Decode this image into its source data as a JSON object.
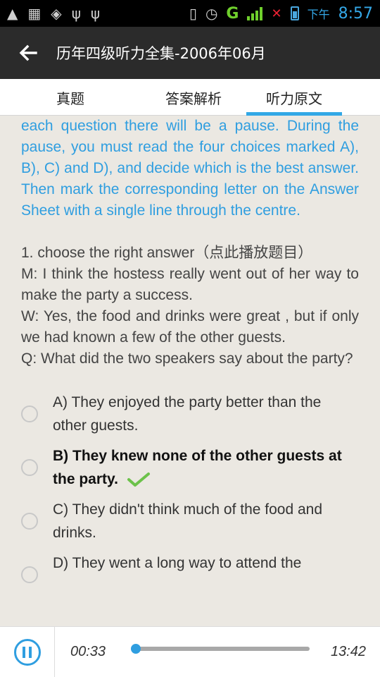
{
  "status_bar": {
    "icons": [
      "android-icon",
      "app-notification-icon",
      "android-debug-icon",
      "usb-icon",
      "usb-icon"
    ],
    "network": "G",
    "ampm": "下午",
    "time": "8:57",
    "colors": {
      "accent": "#34a8e8",
      "signal": "#6fcf2c"
    }
  },
  "header": {
    "title": "历年四级听力全集-2006年06月"
  },
  "tabs": [
    {
      "label": "真题",
      "active": false
    },
    {
      "label": "答案解析",
      "active": false
    },
    {
      "label": "听力原文",
      "active": true
    }
  ],
  "content": {
    "intro": "each question there will be a pause. During the pause, you must read the four choices marked A), B), C) and D), and decide which is the best answer. Then mark the corresponding letter on the Answer Sheet with a single line through the centre.",
    "question_heading": "1. choose the right answer（点此播放题目）",
    "dialogue": [
      "M: I think the hostess really went out of her way to make the party a success.",
      "W: Yes, the food and drinks were great , but if only we had known a few of the other guests.",
      "Q: What did the two speakers say about the party?"
    ],
    "options": [
      {
        "text": "A) They enjoyed the party better than the other guests.",
        "correct": false
      },
      {
        "text": "B) They knew none of the other guests at the party.",
        "correct": true
      },
      {
        "text": "C) They didn't think much of the food and drinks.",
        "correct": false
      },
      {
        "text": "D) They went a long way to attend the",
        "correct": false
      }
    ]
  },
  "player": {
    "current_time": "00:33",
    "total_time": "13:42",
    "progress": 0.04
  }
}
